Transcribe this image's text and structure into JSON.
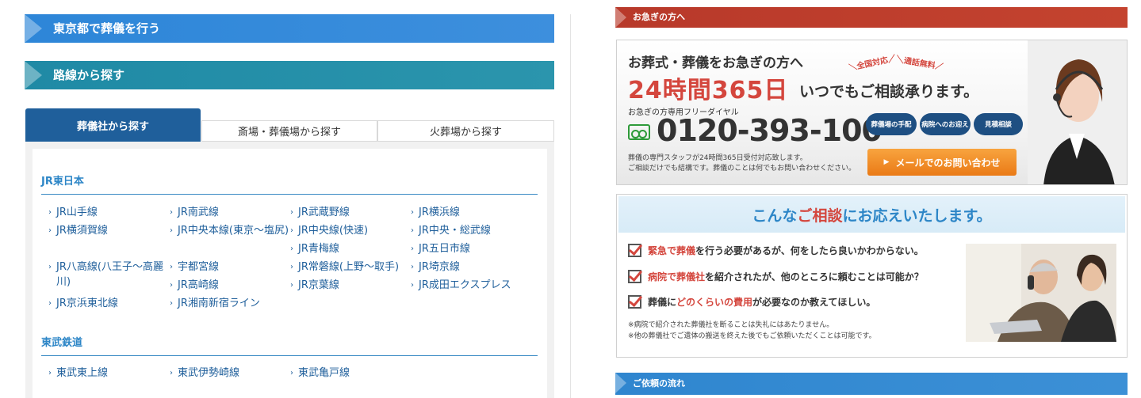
{
  "left": {
    "banner_tokyo": "東京都で葬儀を行う",
    "banner_route": "路線から探す",
    "tabs": [
      {
        "label": "葬儀社から探す",
        "active": true
      },
      {
        "label": "斎場・葬儀場から探す",
        "active": false
      },
      {
        "label": "火葬場から探す",
        "active": false
      }
    ],
    "sections": [
      {
        "heading": "JR東日本",
        "lines": [
          "JR山手線",
          "JR南武線",
          "JR武蔵野線",
          "JR横浜線",
          "JR横須賀線",
          "JR中央本線(東京～塩尻)",
          "JR中央線(快速)",
          "JR中央・総武線",
          "JR青梅線",
          "JR五日市線",
          "JR八高線(八王子～高麗川)",
          "宇都宮線",
          "JR常磐線(上野～取手)",
          "JR埼京線",
          "JR高崎線",
          "JR京葉線",
          "JR成田エクスプレス",
          "JR京浜東北線",
          "JR湘南新宿ライン"
        ]
      },
      {
        "heading": "東武鉄道",
        "lines": [
          "東武東上線",
          "東武伊勢崎線",
          "東武亀戸線"
        ]
      }
    ]
  },
  "right": {
    "urgent_banner": "お急ぎの方へ",
    "contact": {
      "title": "お葬式・葬儀をお急ぎの方へ",
      "hours": "24時間365日",
      "hours_sub": "いつでもご相談承ります。",
      "tag_nationwide": "全国対応",
      "tag_free": "通話無料",
      "freedial_label": "お急ぎの方専用フリーダイヤル",
      "phone": "0120-393-100",
      "note_line1": "葬儀の専門スタッフが24時間365日受付対応致します。",
      "note_line2": "ご相談だけでも結構です。葬儀のことは何でもお問い合わせください。",
      "pills": [
        "葬儀場の手配",
        "病院へのお迎え",
        "見積相談"
      ],
      "mail_button": "メールでのお問い合わせ"
    },
    "consult": {
      "head_a": "こんな",
      "head_b": "ご相談",
      "head_c": "にお応えいたします。",
      "items": [
        {
          "em": "緊急で葬儀",
          "rest": "を行う必要があるが、何をしたら良いかわからない。"
        },
        {
          "em": "病院で葬儀社",
          "rest": "を紹介されたが、他のところに頼むことは可能か？"
        },
        {
          "pre": "葬儀に",
          "em": "どのくらいの費用",
          "rest": "が必要なのか教えてほしい。"
        }
      ],
      "note_line1": "※病院で紹介された葬儀社を断ることは失礼にはあたりません。",
      "note_line2": "※他の葬儀社でご遺体の搬送を終えた後でもご依頼いただくことは可能です。"
    },
    "flow_banner": "ご依頼の流れ"
  },
  "colors": {
    "banner_blue": "#2d86d8",
    "banner_teal": "#1f8aa5",
    "tab_active": "#1f5f9b",
    "link_blue": "#1f5f9b",
    "accent_red": "#d4463d",
    "urgent_red": "#b8392a",
    "mail_orange": "#ea7a16",
    "pill_navy": "#1e4f82"
  }
}
